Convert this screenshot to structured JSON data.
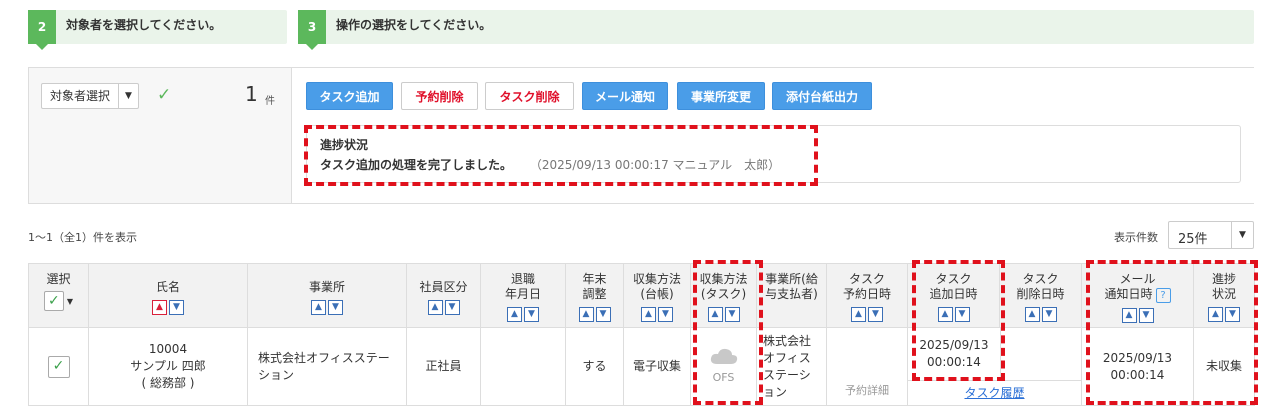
{
  "steps": [
    {
      "num": "2",
      "label": "対象者を選択してください。"
    },
    {
      "num": "3",
      "label": "操作の選択をしてください。"
    }
  ],
  "selector": {
    "value": "対象者選択",
    "count": "1",
    "count_unit": "件"
  },
  "buttons": {
    "add_task": "タスク追加",
    "delete_reservation": "予約削除",
    "delete_task": "タスク削除",
    "mail_notify": "メール通知",
    "office_change": "事業所変更",
    "attachment_output": "添付台紙出力"
  },
  "progress": {
    "title": "進捗状況",
    "message": "タスク追加の処理を完了しました。",
    "meta": "（2025/09/13 00:00:17 マニュアル　太郎）"
  },
  "list": {
    "summary": "1～1（全1）件を表示",
    "page_size_label": "表示件数",
    "page_size_value": "25件"
  },
  "table": {
    "headers": {
      "select": "選択",
      "name": "氏名",
      "office": "事業所",
      "employee_type": "社員区分",
      "retire_1": "退職",
      "retire_2": "年月日",
      "year_end_1": "年末",
      "year_end_2": "調整",
      "collect_ledger_1": "収集方法",
      "collect_ledger_2": "(台帳)",
      "collect_task_1": "収集方法",
      "collect_task_2": "(タスク)",
      "payer_1": "事業所(給",
      "payer_2": "与支払者)",
      "task_reserve_1": "タスク",
      "task_reserve_2": "予約日時",
      "task_add_1": "タスク",
      "task_add_2": "追加日時",
      "task_delete_1": "タスク",
      "task_delete_2": "削除日時",
      "mail_1": "メール",
      "mail_2": "通知日時",
      "status_1": "進捗",
      "status_2": "状況"
    },
    "row": {
      "id": "10004",
      "name": "サンプル 四郎",
      "dept": "( 総務部 )",
      "office_1": "株式会社オフィスステー",
      "office_2": "ション",
      "employee_type": "正社員",
      "retire_date": "",
      "year_end": "する",
      "collect_ledger": "電子収集",
      "collect_task": "OFS",
      "payer_1": "株式会社",
      "payer_2": "オフィス",
      "payer_3": "ステーシ",
      "payer_4": "ョン",
      "reserve_detail": "予約詳細",
      "task_add_date": "2025/09/13",
      "task_add_time": "00:00:14",
      "task_history": "タスク履歴",
      "mail_date": "2025/09/13",
      "mail_time": "00:00:14",
      "status": "未収集"
    }
  },
  "colors": {
    "green": "#5cb85c",
    "blue_button": "#4a9de8",
    "red_text": "#e0102a",
    "highlight_dash": "#e0111c"
  }
}
